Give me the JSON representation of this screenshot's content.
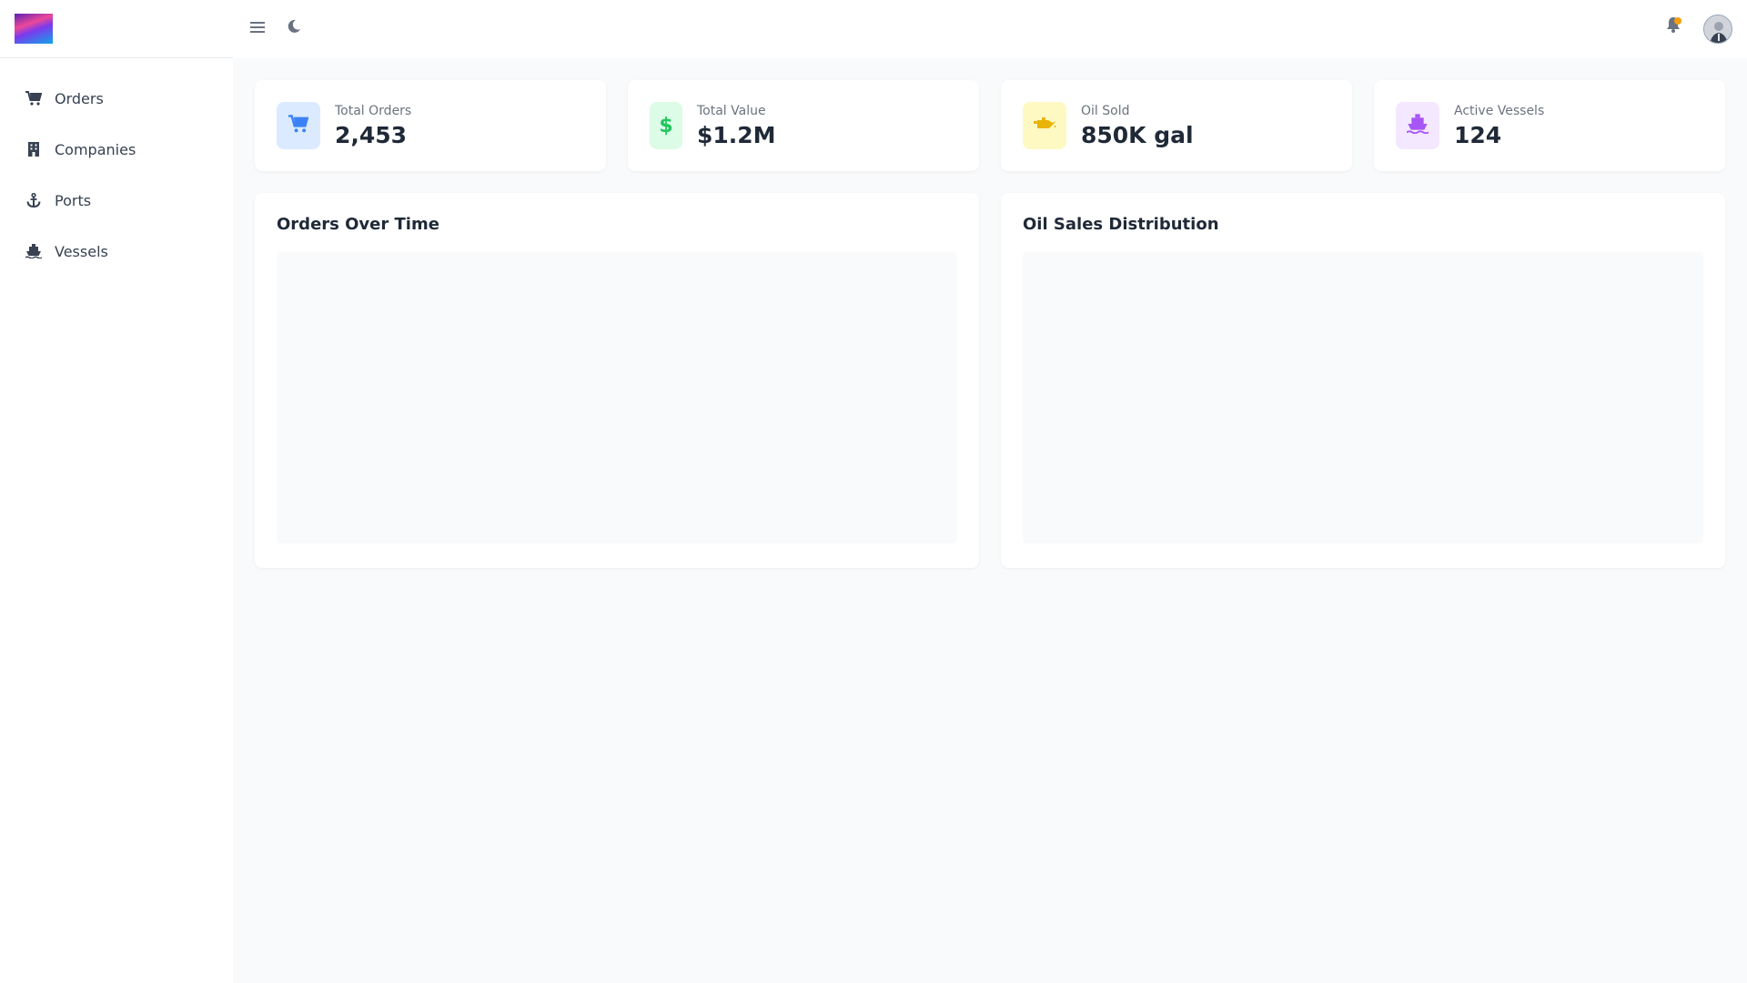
{
  "sidebar": {
    "items": [
      {
        "label": "Orders",
        "icon": "cart-icon"
      },
      {
        "label": "Companies",
        "icon": "building-icon"
      },
      {
        "label": "Ports",
        "icon": "anchor-icon"
      },
      {
        "label": "Vessels",
        "icon": "ship-icon"
      }
    ]
  },
  "stats": [
    {
      "label": "Total Orders",
      "value": "2,453",
      "icon": "cart-icon",
      "icon_color": "#3b82f6",
      "icon_bg": "#dbeafe"
    },
    {
      "label": "Total Value",
      "value": "$1.2M",
      "icon": "dollar-icon",
      "icon_color": "#22c55e",
      "icon_bg": "#dcfce7"
    },
    {
      "label": "Oil Sold",
      "value": "850K gal",
      "icon": "oil-can-icon",
      "icon_color": "#eab308",
      "icon_bg": "#fef9c3"
    },
    {
      "label": "Active Vessels",
      "value": "124",
      "icon": "ship-icon",
      "icon_color": "#a855f7",
      "icon_bg": "#f3e8ff"
    }
  ],
  "charts": [
    {
      "title": "Orders Over Time"
    },
    {
      "title": "Oil Sales Distribution"
    }
  ],
  "colors": {
    "notification_dot": "#f59e0b"
  }
}
